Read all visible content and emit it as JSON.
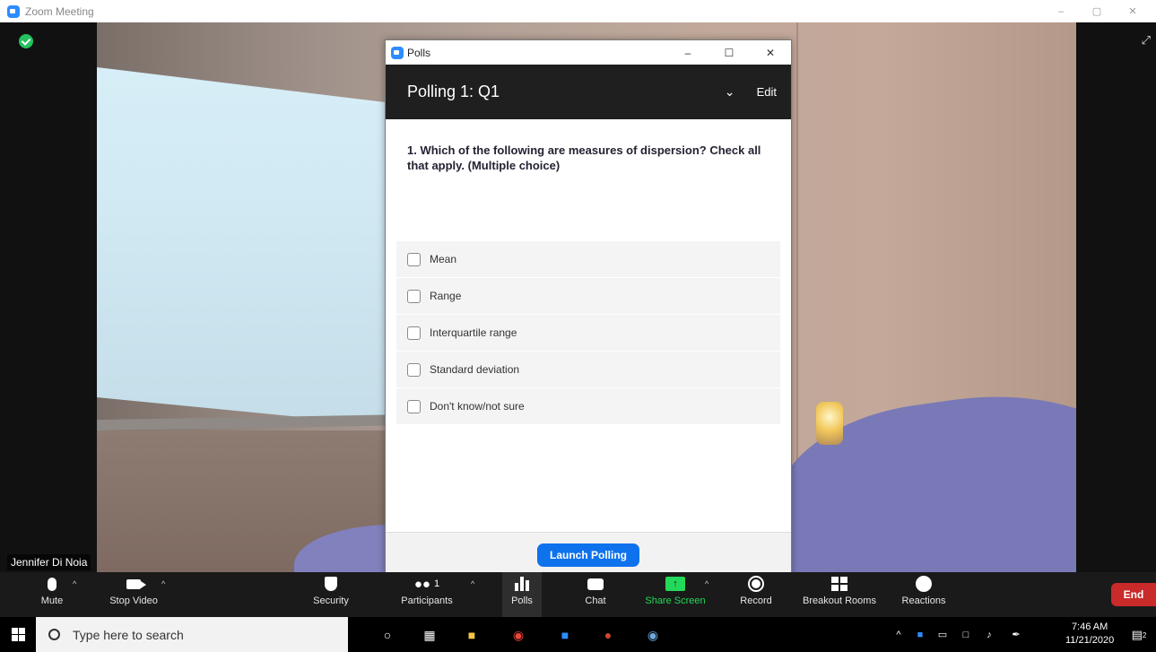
{
  "window": {
    "title": "Zoom Meeting",
    "controls": [
      "–",
      "▢",
      "✕"
    ]
  },
  "video": {
    "participant_name": "Jennifer Di Noia"
  },
  "polls_window": {
    "title": "Polls",
    "controls": [
      "–",
      "☐",
      "✕"
    ],
    "poll_title": "Polling 1: Q1",
    "edit_label": "Edit",
    "question": "1. Which of the following are measures of dispersion? Check all that apply. (Multiple choice)",
    "options": [
      "Mean",
      "Range",
      "Interquartile range",
      "Standard deviation",
      "Don't know/not sure"
    ],
    "launch_label": "Launch Polling"
  },
  "toolbar": {
    "mute": "Mute",
    "stop_video": "Stop Video",
    "security": "Security",
    "participants": "Participants",
    "participants_count": "1",
    "polls": "Polls",
    "chat": "Chat",
    "share_screen": "Share Screen",
    "record": "Record",
    "breakout_rooms": "Breakout Rooms",
    "reactions": "Reactions",
    "end": "End"
  },
  "taskbar": {
    "search_placeholder": "Type here to search",
    "time": "7:46 AM",
    "date": "11/21/2020",
    "notification_count": "2"
  },
  "colors": {
    "zoom_blue": "#2D8CFF",
    "launch_blue": "#0E72ED",
    "end_red": "#C92A2A",
    "share_green": "#23D959"
  }
}
